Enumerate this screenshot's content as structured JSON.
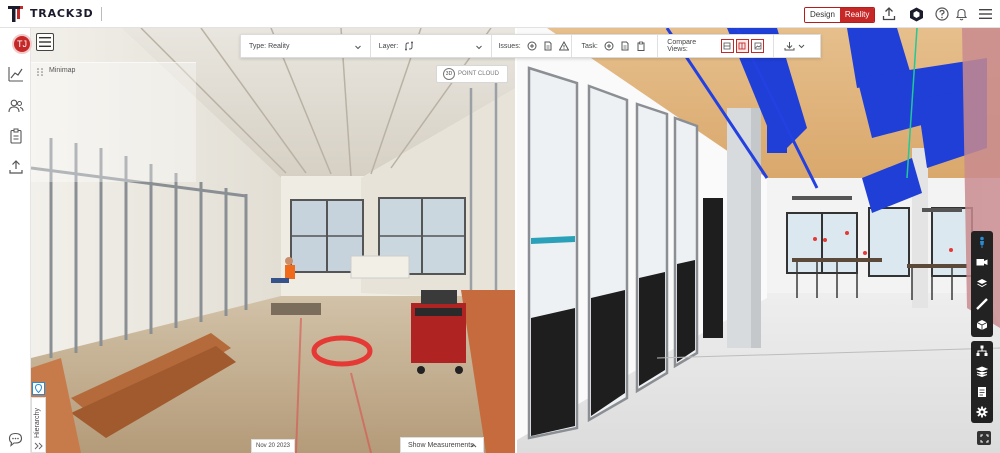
{
  "brand": {
    "name": "TRACK3D"
  },
  "mode_toggle": {
    "design": "Design",
    "reality": "Reality"
  },
  "user": {
    "initials": "TJ"
  },
  "toolbar": {
    "type_label": "Type: Reality",
    "layer_label": "Layer:",
    "issues_label": "Issues:",
    "task_label": "Task:",
    "compare_label": "Compare Views:"
  },
  "minimap": {
    "label": "Minimap"
  },
  "pointcloud": {
    "badge": "3D",
    "label": "POINT CLOUD"
  },
  "hierarchy": {
    "label": "Hierarchy"
  },
  "capture": {
    "date": "Nov 20 2023"
  },
  "measurements": {
    "label": "Show Measurements"
  },
  "icons": {
    "top": [
      "upload-icon",
      "hex-badge-icon",
      "help-icon",
      "bell-icon",
      "menu-icon"
    ],
    "sidebar": [
      "chart-icon",
      "users-icon",
      "clipboard-icon",
      "upload-icon",
      "chat-icon"
    ],
    "right_tools": [
      "person-icon",
      "video-icon",
      "layers-icon",
      "ruler-icon",
      "cube-icon",
      "hierarchy-icon",
      "stack-icon",
      "file-icon",
      "gear-icon",
      "fullscreen-icon"
    ]
  },
  "colors": {
    "accent": "#c62828",
    "duct": "#1f3fd6",
    "markup": "#e53935"
  }
}
